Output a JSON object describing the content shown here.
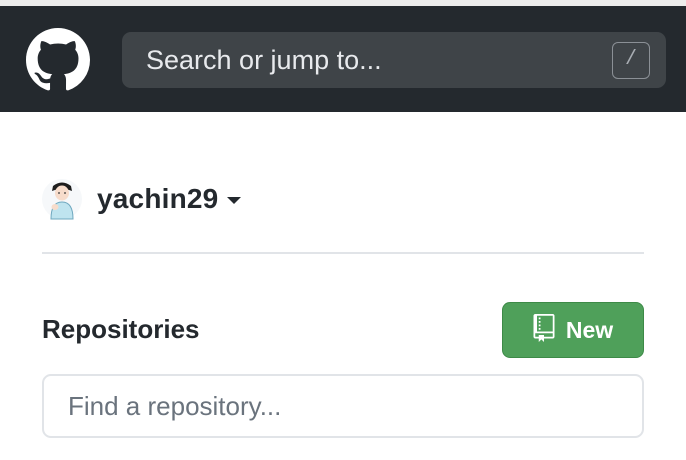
{
  "header": {
    "logo_icon": "github-octocat-icon",
    "search": {
      "placeholder": "Search or jump to...",
      "shortcut_key": "/"
    }
  },
  "context": {
    "username": "yachin29",
    "avatar_icon": "user-avatar",
    "dropdown_icon": "caret-down-icon"
  },
  "repositories": {
    "heading": "Repositories",
    "new_button": {
      "label": "New",
      "icon": "repo-icon"
    },
    "find": {
      "placeholder": "Find a repository..."
    }
  },
  "colors": {
    "header_bg": "#24292e",
    "search_bg": "#3f4448",
    "new_button_bg": "#4fa05a"
  }
}
